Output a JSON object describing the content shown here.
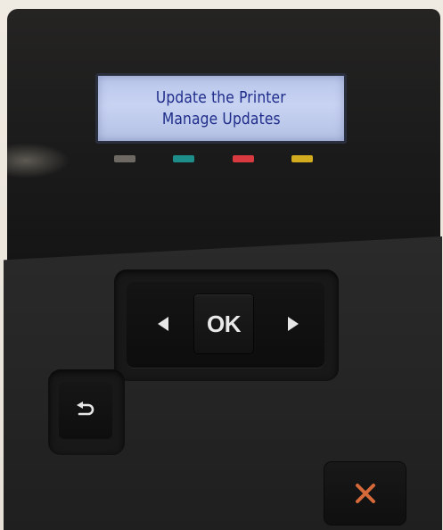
{
  "display": {
    "line1": "Update the Printer",
    "line2": "Manage Updates"
  },
  "indicators": [
    {
      "name": "gray",
      "color": "#6e6a63"
    },
    {
      "name": "teal",
      "color": "#1e8e8b"
    },
    {
      "name": "red",
      "color": "#d83a3f"
    },
    {
      "name": "yellow",
      "color": "#d2ab1f"
    }
  ],
  "controls": {
    "ok_label": "OK",
    "left_icon": "left-arrow-icon",
    "right_icon": "right-arrow-icon",
    "back_icon": "back-arrow-icon",
    "cancel_icon": "cancel-x-icon",
    "cancel_color": "#d6693a"
  }
}
